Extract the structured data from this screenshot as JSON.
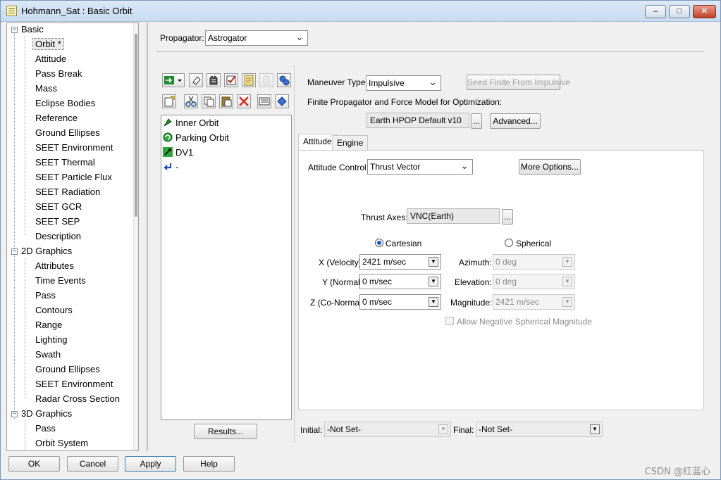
{
  "window": {
    "title": "Hohmann_Sat : Basic Orbit",
    "controls": {
      "minimize": "–",
      "maximize": "□",
      "close": "✕"
    }
  },
  "tree": {
    "groups": [
      {
        "label": "Basic",
        "expander": "−",
        "items": [
          "Orbit *",
          "Attitude",
          "Pass Break",
          "Mass",
          "Eclipse Bodies",
          "Reference",
          "Ground Ellipses",
          "SEET Environment",
          "SEET Thermal",
          "SEET Particle Flux",
          "SEET Radiation",
          "SEET GCR",
          "SEET SEP",
          "Description"
        ]
      },
      {
        "label": "2D Graphics",
        "expander": "−",
        "items": [
          "Attributes",
          "Time Events",
          "Pass",
          "Contours",
          "Range",
          "Lighting",
          "Swath",
          "Ground Ellipses",
          "SEET Environment",
          "Radar Cross Section"
        ]
      },
      {
        "label": "3D Graphics",
        "expander": "−",
        "items": [
          "Pass",
          "Orbit System"
        ]
      }
    ],
    "selected": "Orbit *"
  },
  "propagator": {
    "label": "Propagator:",
    "value": "Astrogator"
  },
  "sequence": {
    "items": [
      {
        "label": "Inner Orbit",
        "icon": "initial-state-icon"
      },
      {
        "label": "Parking Orbit",
        "icon": "propagate-icon"
      },
      {
        "label": "DV1",
        "icon": "maneuver-icon"
      },
      {
        "label": "-",
        "icon": "return-arrow-icon"
      }
    ],
    "results_button": "Results..."
  },
  "maneuver": {
    "type_label": "Maneuver Type:",
    "type_value": "Impulsive",
    "seed_button": "Seed Finite From Impulsive",
    "finite_label": "Finite Propagator and Force Model for Optimization:",
    "finite_value": "Earth HPOP Default v10",
    "ellipsis": "...",
    "advanced_button": "Advanced..."
  },
  "tabs": {
    "attitude": "Attitude",
    "engine": "Engine"
  },
  "attitude": {
    "control_label": "Attitude Control:",
    "control_value": "Thrust Vector",
    "more_options": "More Options...",
    "thrust_axes_label": "Thrust Axes:",
    "thrust_axes_value": "VNC(Earth)",
    "cartesian": "Cartesian",
    "spherical": "Spherical",
    "x_label": "X (Velocity):",
    "x_value": "2421 m/sec",
    "y_label": "Y (Normal):",
    "y_value": "0 m/sec",
    "z_label": "Z (Co-Normal):",
    "z_value": "0 m/sec",
    "azimuth_label": "Azimuth:",
    "azimuth_value": "0 deg",
    "elevation_label": "Elevation:",
    "elevation_value": "0 deg",
    "magnitude_label": "Magnitude:",
    "magnitude_value": "2421 m/sec",
    "allow_negative": "Allow Negative Spherical Magnitude"
  },
  "mass": {
    "initial_label": "Initial:",
    "initial_value": "-Not Set-",
    "final_label": "Final:",
    "final_value": "-Not Set-"
  },
  "footer": {
    "ok": "OK",
    "cancel": "Cancel",
    "apply": "Apply",
    "help": "Help"
  },
  "watermark": "CSDN @红蓝心",
  "colors": {
    "accent": "#1a5fd0",
    "selection": "#eaeaea",
    "title_bar": "#c8dbf0"
  }
}
